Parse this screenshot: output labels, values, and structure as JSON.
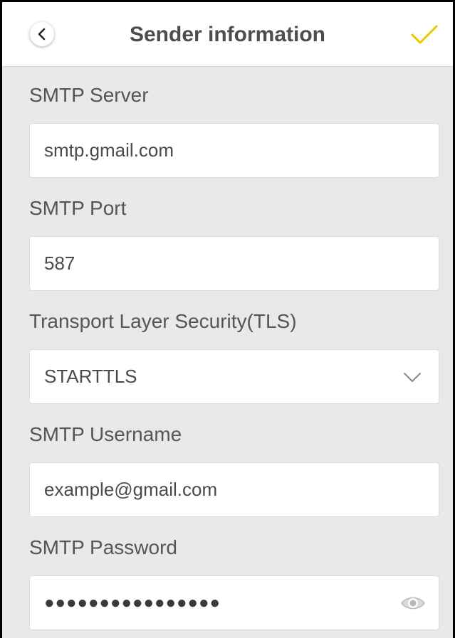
{
  "header": {
    "title": "Sender information",
    "back_icon": "chevron-left-icon",
    "confirm_icon": "checkmark-icon",
    "accent_color": "#f5c400"
  },
  "form": {
    "smtp_server": {
      "label": "SMTP Server",
      "value": "smtp.gmail.com"
    },
    "smtp_port": {
      "label": "SMTP Port",
      "value": "587"
    },
    "tls": {
      "label": "Transport Layer Security(TLS)",
      "value": "STARTTLS",
      "icon": "chevron-down-icon"
    },
    "smtp_username": {
      "label": "SMTP Username",
      "value": "example@gmail.com"
    },
    "smtp_password": {
      "label": "SMTP Password",
      "value": "●●●●●●●●●●●●●●●●",
      "icon": "eye-icon"
    }
  }
}
